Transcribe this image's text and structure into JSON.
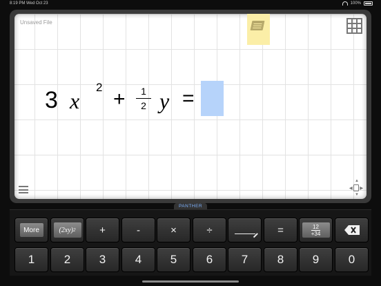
{
  "status_bar": {
    "time": "8:19 PM",
    "date": "Wed Oct 23",
    "battery": "100%"
  },
  "canvas": {
    "file_name": "Unsaved File",
    "equation": {
      "coefficient": "3",
      "var_x": "x",
      "exponent": "2",
      "plus": "+",
      "frac_num": "1",
      "frac_den": "2",
      "var_y": "y",
      "equals": "="
    }
  },
  "brand": "PANTHER",
  "keyboard": {
    "row1": {
      "more": "More",
      "power_base": "(2xy)",
      "power_exp": "2",
      "plus": "+",
      "minus": "-",
      "times": "×",
      "divide": "÷",
      "equals": "=",
      "mixed_top": "12",
      "mixed_bottom": "+34"
    },
    "row2": [
      "1",
      "2",
      "3",
      "4",
      "5",
      "6",
      "7",
      "8",
      "9",
      "0"
    ]
  }
}
